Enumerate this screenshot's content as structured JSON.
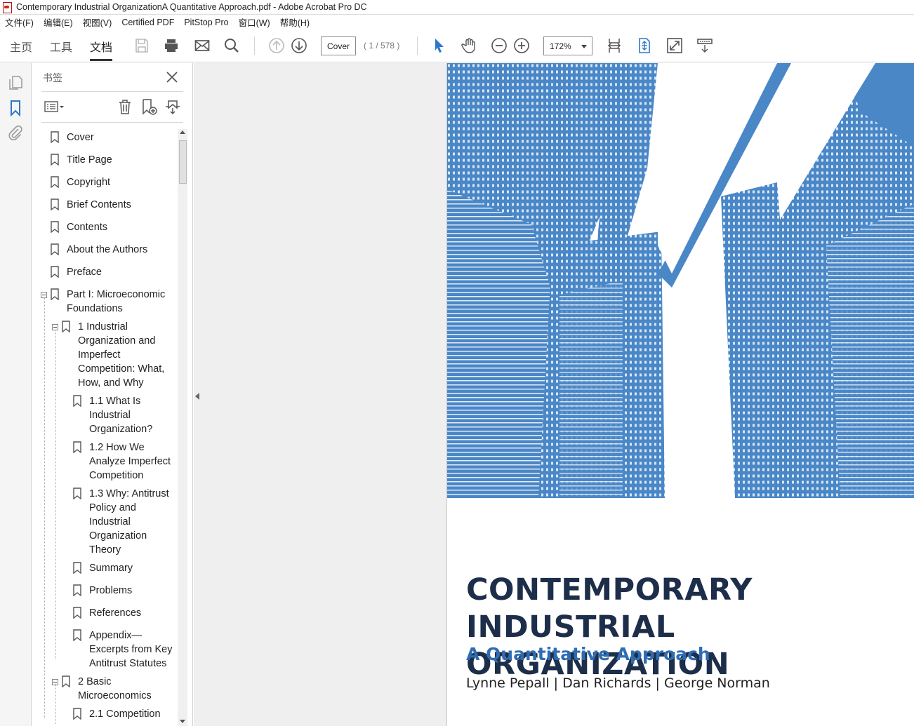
{
  "window": {
    "title": "Contemporary Industrial OrganizationA Quantitative Approach.pdf - Adobe Acrobat Pro DC"
  },
  "menu": {
    "items": [
      "文件(F)",
      "编辑(E)",
      "视图(V)",
      "Certified PDF",
      "PitStop Pro",
      "窗口(W)",
      "帮助(H)"
    ]
  },
  "toolbar": {
    "tabs": [
      "主页",
      "工具",
      "文档"
    ],
    "active_tab": "文档",
    "page_field": "Cover",
    "page_count": "( 1 / 578 )",
    "zoom": "172%"
  },
  "icons": {
    "save": "save-icon",
    "print": "print-icon",
    "email": "email-icon",
    "search": "search-icon",
    "prev_page": "arrow-up-circle-icon",
    "next_page": "arrow-down-circle-icon",
    "select": "pointer-arrow-icon",
    "hand": "hand-tool-icon",
    "zoom_out": "zoom-out-icon",
    "zoom_in": "zoom-in-icon",
    "fit_width": "fit-width-icon",
    "fit_page": "fit-page-icon",
    "full_screen": "full-screen-icon",
    "read_mode": "read-mode-icon"
  },
  "bookmarks_panel": {
    "title": "书签",
    "items": [
      {
        "label": "Cover"
      },
      {
        "label": "Title Page"
      },
      {
        "label": "Copyright"
      },
      {
        "label": "Brief Contents"
      },
      {
        "label": "Contents"
      },
      {
        "label": "About the Authors"
      },
      {
        "label": "Preface"
      },
      {
        "label": "Part I: Microeconomic\nFoundations"
      },
      {
        "label": "1 Industrial\nOrganization and\nImperfect\nCompetition: What,\nHow, and Why"
      },
      {
        "label": "1.1 What Is\nIndustrial\nOrganization?"
      },
      {
        "label": "1.2 How We\nAnalyze Imperfect\nCompetition"
      },
      {
        "label": "1.3 Why: Antitrust\nPolicy and\nIndustrial\nOrganization\nTheory"
      },
      {
        "label": "Summary"
      },
      {
        "label": "Problems"
      },
      {
        "label": "References"
      },
      {
        "label": "Appendix—\nExcerpts from Key\nAntitrust Statutes"
      },
      {
        "label": "2 Basic\nMicroeconomics"
      },
      {
        "label": "2.1 Competition"
      }
    ]
  },
  "document": {
    "cover_title": "CONTEMPORARY INDUSTRIAL ORGANIZATION",
    "cover_subtitle": "A Quantitative Approach",
    "cover_authors": "Lynne Pepall | Dan Richards | George Norman",
    "accent_color": "#4a87c7",
    "title_color": "#1d2e4a"
  }
}
